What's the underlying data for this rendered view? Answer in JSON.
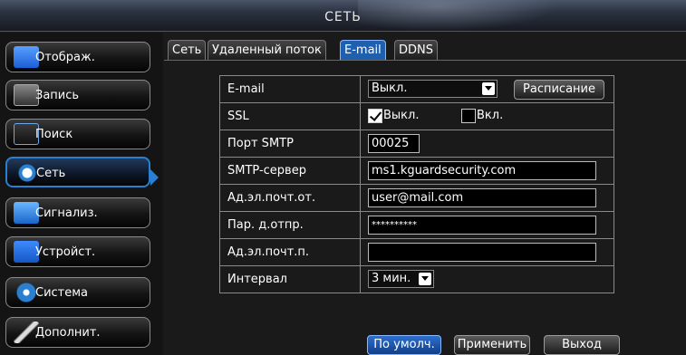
{
  "window": {
    "title": "СЕТЬ"
  },
  "sidebar": {
    "items": [
      {
        "label": "Отображ.",
        "icon": "monitor-icon"
      },
      {
        "label": "Запись",
        "icon": "record-icon"
      },
      {
        "label": "Поиск",
        "icon": "search-icon"
      },
      {
        "label": "Сеть",
        "icon": "network-icon",
        "active": true
      },
      {
        "label": "Сигнализ.",
        "icon": "alarm-icon"
      },
      {
        "label": "Устройст.",
        "icon": "device-icon"
      },
      {
        "label": "Система",
        "icon": "system-icon"
      },
      {
        "label": "Дополнит.",
        "icon": "advanced-icon"
      }
    ]
  },
  "tabs": [
    "Сеть",
    "Удаленный поток",
    "E-mail",
    "DDNS"
  ],
  "active_tab": "E-mail",
  "form": {
    "email": {
      "label": "E-mail",
      "value": "Выкл.",
      "schedule_button": "Расписание"
    },
    "ssl": {
      "label": "SSL",
      "off_label": "Выкл.",
      "on_label": "Вкл.",
      "selected": "Выкл."
    },
    "smtp_port": {
      "label": "Порт SMTP",
      "value": "00025"
    },
    "smtp_server": {
      "label": "SMTP-сервер",
      "value": "ms1.kguardsecurity.com"
    },
    "sender": {
      "label": "Ад.эл.почт.от.",
      "value": "user@mail.com"
    },
    "password": {
      "label": "Пар. д.отпр.",
      "value": "**********"
    },
    "receiver": {
      "label": "Ад.эл.почт.п.",
      "value": ""
    },
    "interval": {
      "label": "Интервал",
      "value": "3 мин."
    }
  },
  "buttons": {
    "default": "По умолч.",
    "apply": "Применить",
    "exit": "Выход"
  },
  "colors": {
    "accent": "#2a7fd0",
    "background": "#1a1a1a"
  }
}
